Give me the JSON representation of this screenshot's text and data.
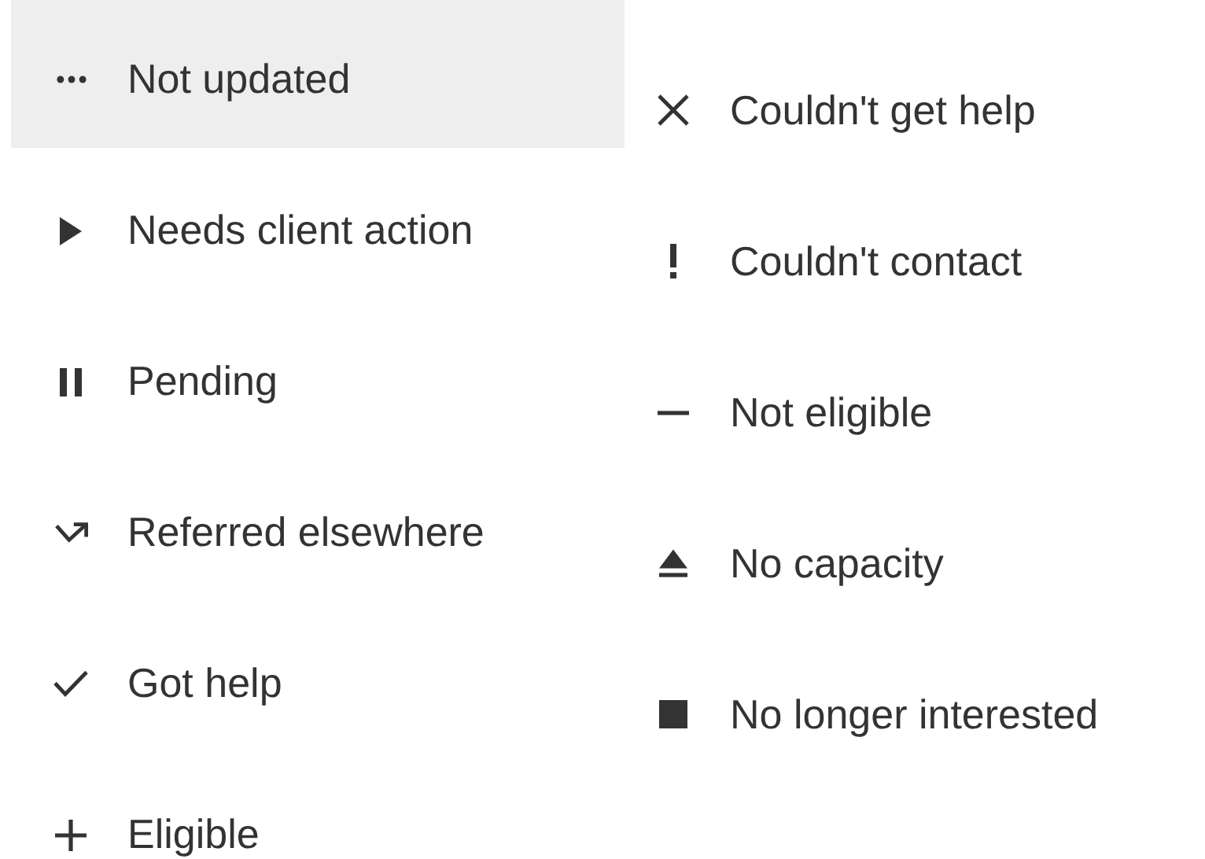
{
  "menu_left": [
    {
      "label": "Not updated",
      "selected": true
    },
    {
      "label": "Needs client action",
      "selected": false
    },
    {
      "label": "Pending",
      "selected": false
    },
    {
      "label": "Referred elsewhere",
      "selected": false
    },
    {
      "label": "Got help",
      "selected": false
    },
    {
      "label": "Eligible",
      "selected": false
    }
  ],
  "menu_right": [
    {
      "label": "Couldn't get help",
      "selected": false
    },
    {
      "label": "Couldn't contact",
      "selected": false
    },
    {
      "label": "Not eligible",
      "selected": false
    },
    {
      "label": "No capacity",
      "selected": false
    },
    {
      "label": "No longer interested",
      "selected": false
    }
  ]
}
